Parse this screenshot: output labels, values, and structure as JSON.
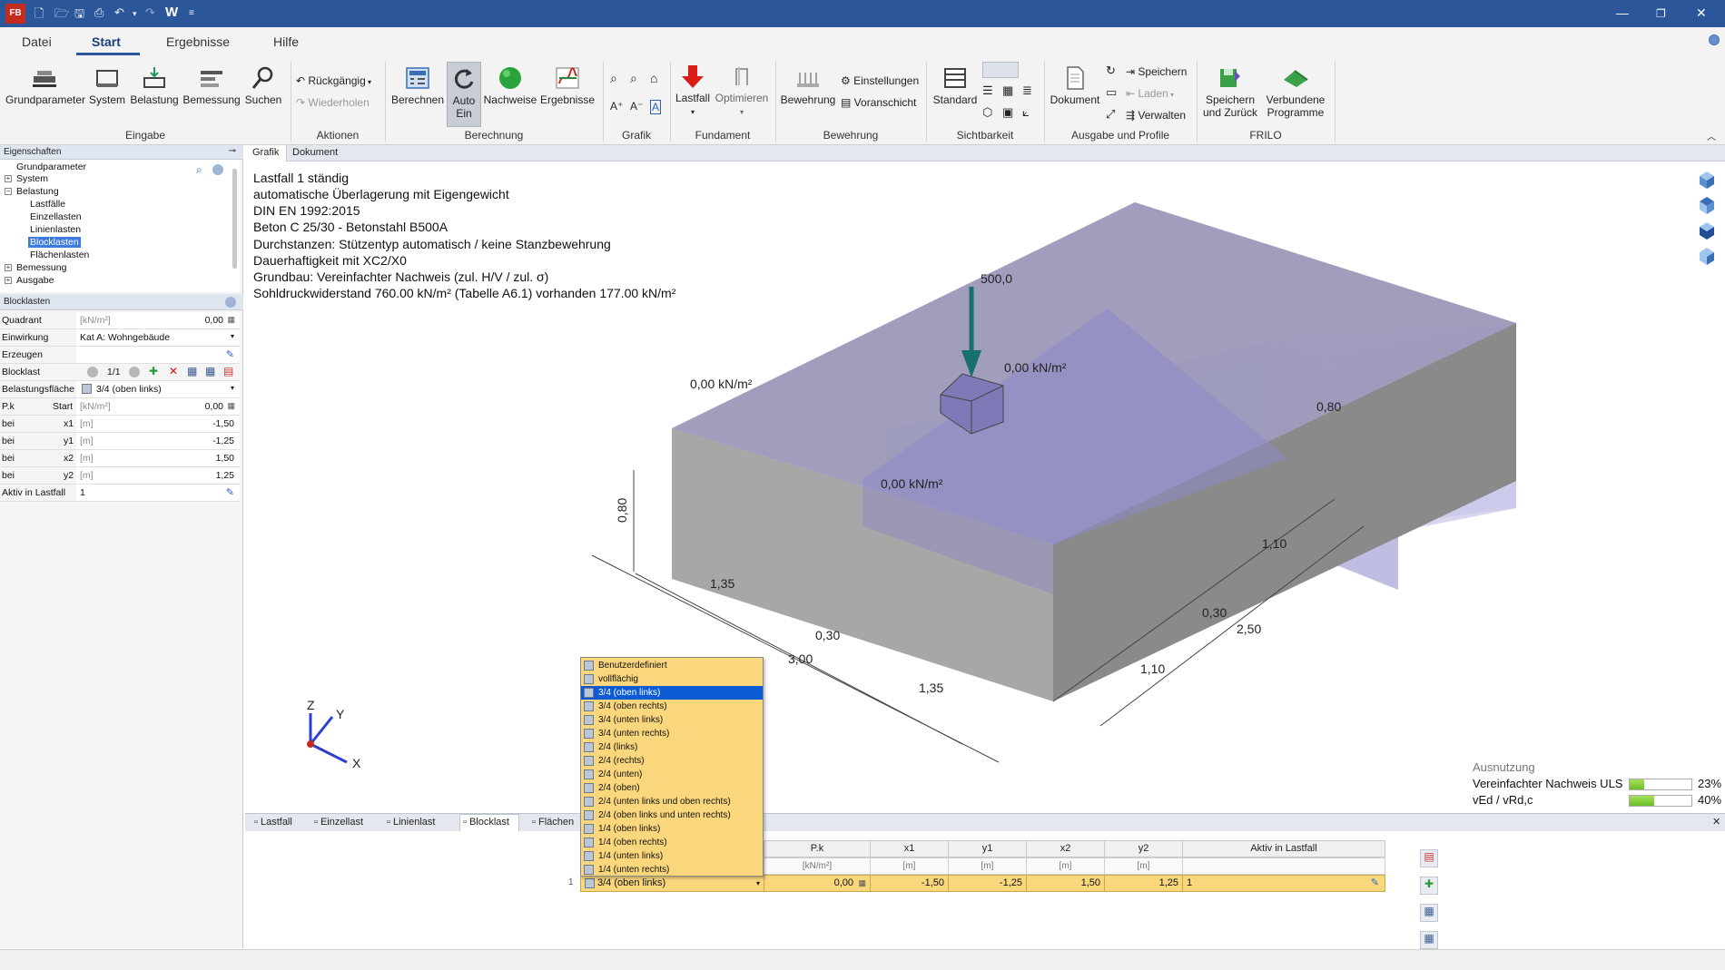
{
  "window": {
    "app_icon": "FB",
    "qat_letter": "W"
  },
  "menu": {
    "tabs": [
      "Datei",
      "Start",
      "Ergebnisse",
      "Hilfe"
    ]
  },
  "ribbon": {
    "buttons": {
      "grundparameter": "Grundparameter",
      "system": "System",
      "belastung": "Belastung",
      "bemessung": "Bemessung",
      "suchen": "Suchen",
      "rueckgaengig": "Rückgängig",
      "wiederholen": "Wiederholen",
      "berechnen": "Berechnen",
      "auto_ein": "Auto\nEin",
      "nachweise": "Nachweise",
      "ergebnisse": "Ergebnisse",
      "lastfall": "Lastfall",
      "optimieren": "Optimieren",
      "bewehrung": "Bewehrung",
      "einstellungen": "Einstellungen",
      "voranschicht": "Voranschicht",
      "standard": "Standard",
      "dokument": "Dokument",
      "speichern": "Speichern",
      "laden": "Laden",
      "verwalten": "Verwalten",
      "speichern_zurueck": "Speichern\nund Zurück",
      "verbundene": "Verbundene\nProgramme"
    },
    "groups": [
      "Eingabe",
      "Aktionen",
      "Berechnung",
      "Grafik",
      "Fundament",
      "Bewehrung",
      "Sichtbarkeit",
      "Ausgabe und Profile",
      "FRILO"
    ]
  },
  "properties": {
    "header": "Eigenschaften",
    "tree": [
      "Grundparameter",
      "System",
      "Belastung",
      "Lastfälle",
      "Einzellasten",
      "Linienlasten",
      "Blocklasten",
      "Flächenlasten",
      "Bemessung",
      "Ausgabe"
    ],
    "section": "Blocklasten",
    "rows": [
      {
        "label": "Quadrant",
        "unit": "[kN/m²]",
        "value": "0,00"
      },
      {
        "label": "Einwirkung",
        "value": "Kat A: Wohngebäude"
      },
      {
        "label": "Erzeugen",
        "value": ""
      },
      {
        "label": "Blocklast",
        "value": "1/1"
      },
      {
        "label": "Belastungsfläche",
        "value": "3/4 (oben links)"
      },
      {
        "label": "P.k",
        "label2": "Start",
        "unit": "[kN/m²]",
        "value": "0,00"
      },
      {
        "label": "bei",
        "label2": "x1",
        "unit": "[m]",
        "value": "-1,50"
      },
      {
        "label": "bei",
        "label2": "y1",
        "unit": "[m]",
        "value": "-1,25"
      },
      {
        "label": "bei",
        "label2": "x2",
        "unit": "[m]",
        "value": "1,50"
      },
      {
        "label": "bei",
        "label2": "y2",
        "unit": "[m]",
        "value": "1,25"
      },
      {
        "label": "Aktiv in Lastfall",
        "value": "1"
      }
    ]
  },
  "canvas_tabs": [
    "Grafik",
    "Dokument"
  ],
  "info_lines": [
    "Lastfall 1 ständig",
    "automatische Überlagerung mit Eigengewicht",
    "DIN EN 1992:2015",
    "Beton C 25/30 - Betonstahl B500A",
    "Durchstanzen: Stützentyp automatisch / keine Stanzbewehrung",
    "Dauerhaftigkeit mit XC2/X0",
    "Grundbau: Vereinfachter Nachweis (zul. H/V / zul. σ)",
    "Sohldruckwiderstand 760.00 kN/m² (Tabelle A6.1) vorhanden 177.00 kN/m²"
  ],
  "drawing_labels": {
    "load": "500,0",
    "p1": "0,00 kN/m²",
    "p2": "0,00 kN/m²",
    "p3": "0,00 kN/m²",
    "h": "0,80",
    "h2": "0,80",
    "a1": "1,35",
    "a2": "0,30",
    "a3": "3,00",
    "a4": "1,35",
    "b1": "1,10",
    "b2": "0,30",
    "b3": "2,50",
    "b4": "1,10",
    "ax_x": "X",
    "ax_y": "Y",
    "ax_z": "Z"
  },
  "utilization": {
    "title": "Ausnutzung",
    "items": [
      {
        "label": "Vereinfachter Nachweis ULS",
        "value": "23%",
        "fraction": 0.23
      },
      {
        "label": "vEd / vRd,c",
        "value": "40%",
        "fraction": 0.4
      }
    ]
  },
  "bottom_tabs": [
    "Lastfall",
    "Einzellast",
    "Linienlast",
    "Blocklast",
    "Flächen"
  ],
  "grid": {
    "headers": [
      "P.k",
      "x1",
      "y1",
      "x2",
      "y2",
      "Aktiv in Lastfall"
    ],
    "units": [
      "[kN/m²]",
      "[m]",
      "[m]",
      "[m]",
      "[m]",
      ""
    ],
    "row_num": "1",
    "row": {
      "flaeche": "3/4 (oben links)",
      "pk": "0,00",
      "x1": "-1,50",
      "y1": "-1,25",
      "x2": "1,50",
      "y2": "1,25",
      "aktiv": "1"
    }
  },
  "dropdown": {
    "selected_index": 2,
    "options": [
      "Benutzerdefiniert",
      "vollflächig",
      "3/4 (oben links)",
      "3/4 (oben rechts)",
      "3/4 (unten links)",
      "3/4 (unten rechts)",
      "2/4 (links)",
      "2/4 (rechts)",
      "2/4 (unten)",
      "2/4 (oben)",
      "2/4 (unten links und oben rechts)",
      "2/4 (oben links und unten rechts)",
      "1/4 (oben links)",
      "1/4 (oben rechts)",
      "1/4 (unten links)",
      "1/4 (unten rechts)"
    ]
  }
}
